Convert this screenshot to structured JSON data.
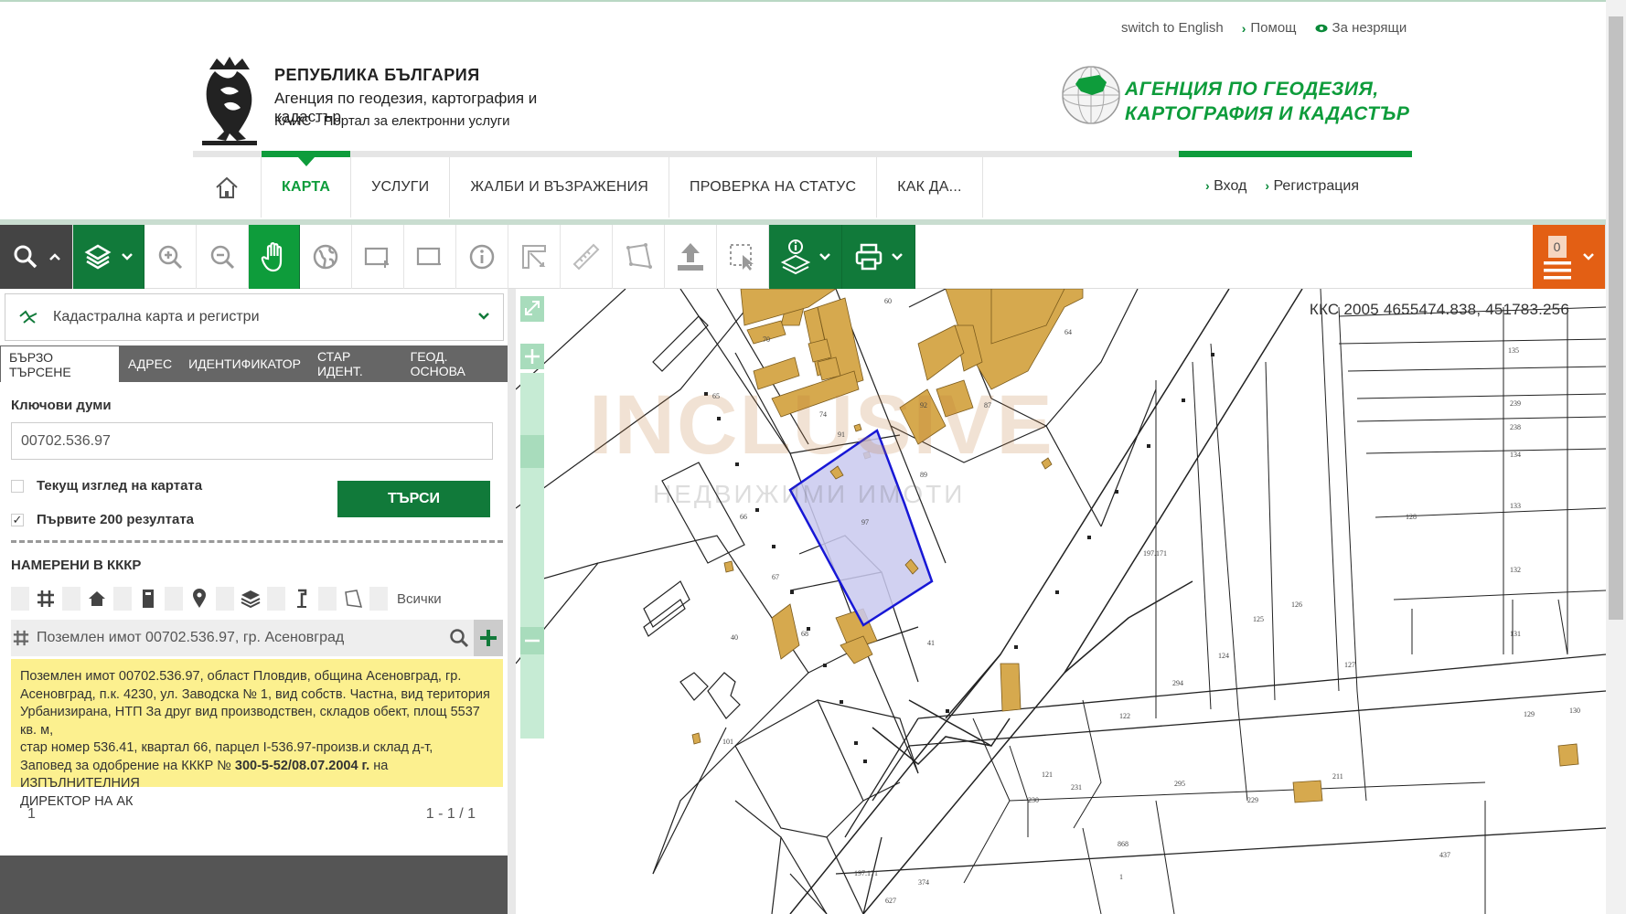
{
  "header": {
    "top_links": {
      "english": "switch to English",
      "help": "Помощ",
      "accessibility": "За незрящи"
    },
    "brand": {
      "title": "РЕПУБЛИКА БЪЛГАРИЯ",
      "line2": "Агенция по геодезия, картография и кадастър",
      "line3": "КАИС - Портал за електронни услуги"
    },
    "agency_logo": {
      "line1": "АГЕНЦИЯ ПО ГЕОДЕЗИЯ,",
      "line2": "КАРТОГРАФИЯ И КАДАСТЪР"
    },
    "nav": {
      "map": "КАРТА",
      "services": "УСЛУГИ",
      "complaints": "ЖАЛБИ И ВЪЗРАЖЕНИЯ",
      "status": "ПРОВЕРКА НА СТАТУС",
      "howto": "КАК ДА..."
    },
    "auth": {
      "login": "Вход",
      "register": "Регистрация"
    }
  },
  "toolbar": {
    "active_tool": "pan",
    "cart_count": "0"
  },
  "sidebar": {
    "datasource": "Кадастрална карта и регистри",
    "tabs": {
      "quick": "БЪРЗО ТЪРСЕНЕ",
      "address": "АДРЕС",
      "identifier": "ИДЕНТИФИКАТОР",
      "old_id": "СТАР ИДЕНТ.",
      "geo": "ГЕОД. ОСНОВА"
    },
    "keywords_label": "Ключови думи",
    "keywords_value": "00702.536.97",
    "current_view_label": "Текущ изглед на картата",
    "first_200_label": "Първите 200 резултата",
    "first_200_check": "✓",
    "search_button": "ТЪРСИ",
    "found_title": "НАМЕРЕНИ В КККР",
    "filters_all": "Всички",
    "result_title": "Поземлен имот 00702.536.97, гр. Асеновград",
    "result_info": {
      "line1": "Поземлен имот 00702.536.97, област Пловдив, община Асеновград, гр.",
      "line2": "Асеновград, п.к. 4230, ул. Заводска № 1, вид собств. Частна, вид територия",
      "line3": "Урбанизирана, НТП За друг вид производствен, складов обект, площ 5537 кв. м,",
      "line4": "стар номер 536.41, квартал 66, парцел I-536.97-произв.и склад д-т,",
      "line5_pre": "Заповед за одобрение на КККР № ",
      "line5_order": "300-5-52/08.07.2004 г.",
      "line5_post": " на ИЗПЪЛНИТЕЛНИЯ",
      "line6": "ДИРЕКТОР НА АК"
    },
    "pager": {
      "page": "1",
      "count": "1 - 1 / 1"
    }
  },
  "map": {
    "coordinates": "ККС 2005 4655474.838, 451783.256",
    "watermark": {
      "brand": "INCLUSIVE",
      "sub": "НЕДВИЖИМИ ИМОТИ"
    },
    "colors": {
      "building": "#d6a94e",
      "selection_fill": "#c9c9ee",
      "selection_stroke": "#1717d6",
      "zoom_green": "#a8dcbc"
    },
    "parcel_labels": [
      {
        "id": "p60",
        "text": "60"
      },
      {
        "id": "p64",
        "text": "64"
      },
      {
        "id": "p70",
        "text": "70"
      },
      {
        "id": "p65",
        "text": "65"
      },
      {
        "id": "p92",
        "text": "92"
      },
      {
        "id": "p87",
        "text": "87"
      },
      {
        "id": "p74",
        "text": "74"
      },
      {
        "id": "p91",
        "text": "91"
      },
      {
        "id": "p89",
        "text": "89"
      },
      {
        "id": "p66",
        "text": "66"
      },
      {
        "id": "p97",
        "text": "97"
      },
      {
        "id": "p67",
        "text": "67"
      },
      {
        "id": "p68",
        "text": "68"
      },
      {
        "id": "p40",
        "text": "40"
      },
      {
        "id": "p41",
        "text": "41"
      },
      {
        "id": "p101",
        "text": "101"
      },
      {
        "id": "p135",
        "text": "135"
      },
      {
        "id": "p239",
        "text": "239"
      },
      {
        "id": "p238",
        "text": "238"
      },
      {
        "id": "p134",
        "text": "134"
      },
      {
        "id": "p133",
        "text": "133"
      },
      {
        "id": "p132",
        "text": "132"
      },
      {
        "id": "p131",
        "text": "131"
      },
      {
        "id": "p128",
        "text": "128"
      },
      {
        "id": "p126",
        "text": "126"
      },
      {
        "id": "p125",
        "text": "125"
      },
      {
        "id": "p124",
        "text": "124"
      },
      {
        "id": "p127",
        "text": "127"
      },
      {
        "id": "p294",
        "text": "294"
      },
      {
        "id": "p122",
        "text": "122"
      },
      {
        "id": "p121",
        "text": "121"
      },
      {
        "id": "p231",
        "text": "231"
      },
      {
        "id": "p295",
        "text": "295"
      },
      {
        "id": "p211",
        "text": "211"
      },
      {
        "id": "p230",
        "text": "230"
      },
      {
        "id": "p229",
        "text": "229"
      },
      {
        "id": "p129",
        "text": "129"
      },
      {
        "id": "p130",
        "text": "130"
      },
      {
        "id": "p868",
        "text": "868"
      },
      {
        "id": "p1",
        "text": "1"
      },
      {
        "id": "p374",
        "text": "374"
      },
      {
        "id": "p627",
        "text": "627"
      },
      {
        "id": "p437",
        "text": "437"
      },
      {
        "id": "p1971",
        "text": "197.171"
      },
      {
        "id": "p1972",
        "text": "197.171"
      }
    ]
  }
}
